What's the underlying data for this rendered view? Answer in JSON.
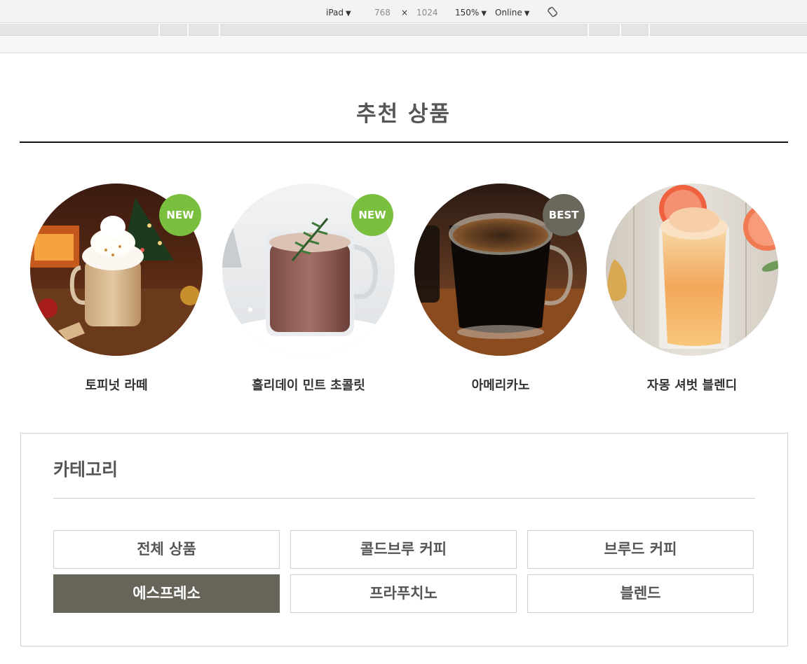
{
  "devtools": {
    "device": "iPad",
    "width": "768",
    "separator": "×",
    "height": "1024",
    "zoom": "150%",
    "throttling": "Online"
  },
  "recommended": {
    "title": "추천 상품",
    "products": [
      {
        "name": "토피넛 라떼",
        "badge": "NEW",
        "badge_color": "#7bbf3f"
      },
      {
        "name": "홀리데이 민트 초콜릿",
        "badge": "NEW",
        "badge_color": "#7bbf3f"
      },
      {
        "name": "아메리카노",
        "badge": "BEST",
        "badge_color": "#6a675d"
      },
      {
        "name": "자몽 셔벗 블렌디",
        "badge": "",
        "badge_color": ""
      }
    ]
  },
  "category": {
    "title": "카테고리",
    "items": [
      {
        "label": "전체 상품",
        "active": false
      },
      {
        "label": "콜드브루 커피",
        "active": false
      },
      {
        "label": "브루드 커피",
        "active": false
      },
      {
        "label": "에스프레소",
        "active": true
      },
      {
        "label": "프라푸치노",
        "active": false
      },
      {
        "label": "블렌드",
        "active": false
      }
    ],
    "active_color": "#67655a"
  }
}
